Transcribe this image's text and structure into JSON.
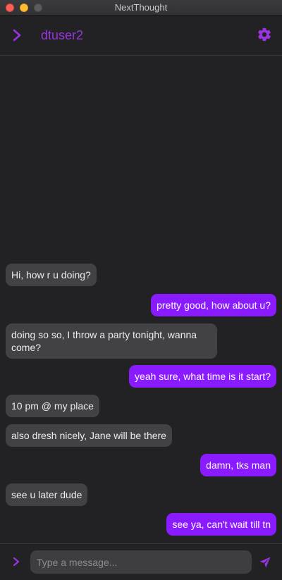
{
  "window": {
    "title": "NextThought"
  },
  "header": {
    "username": "dtuser2",
    "expand_icon": "chevron-right-icon",
    "settings_icon": "gear-icon"
  },
  "colors": {
    "accent": "#9a34e0",
    "outgoing_bubble": "#8a1bff",
    "incoming_bubble": "#424244",
    "background": "#222224"
  },
  "messages": [
    {
      "direction": "incoming",
      "text": "Hi, how r u doing?"
    },
    {
      "direction": "outgoing",
      "text": "pretty good, how about u?"
    },
    {
      "direction": "incoming",
      "text": "doing so so, I throw a party tonight, wanna come?"
    },
    {
      "direction": "outgoing",
      "text": "yeah sure, what time is it start?"
    },
    {
      "direction": "incoming",
      "text": "10 pm @ my place"
    },
    {
      "direction": "incoming",
      "text": "also dresh nicely, Jane will be there"
    },
    {
      "direction": "outgoing",
      "text": "damn, tks man"
    },
    {
      "direction": "incoming",
      "text": "see u later dude"
    },
    {
      "direction": "outgoing",
      "text": "see ya, can't wait till tn"
    }
  ],
  "composer": {
    "placeholder": "Type a message...",
    "value": "",
    "expand_icon": "chevron-right-icon",
    "send_icon": "send-icon"
  }
}
